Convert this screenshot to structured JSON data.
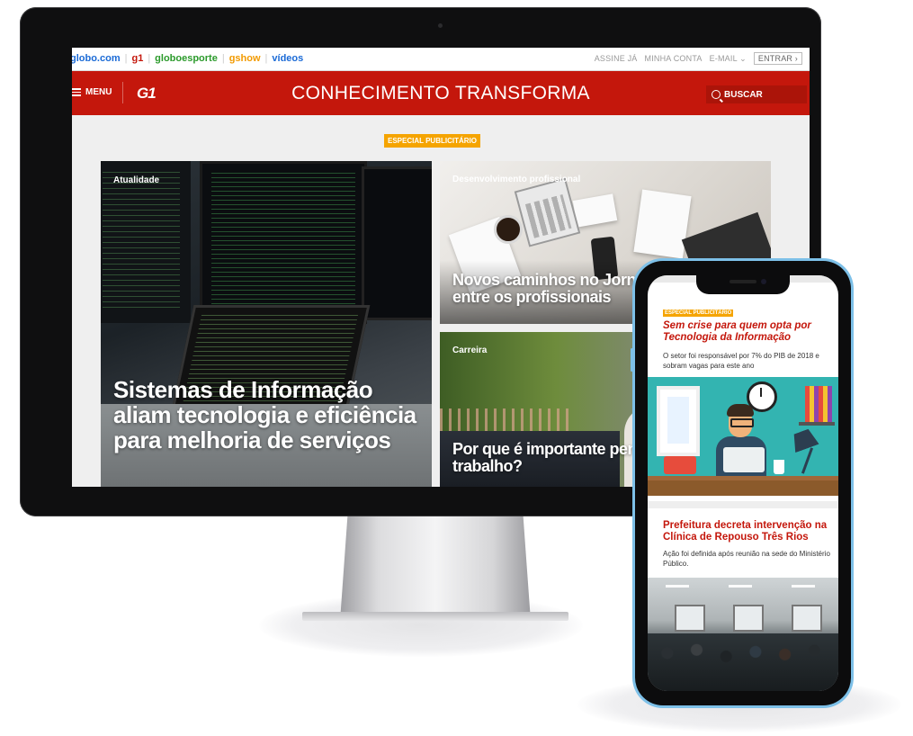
{
  "colors": {
    "brand_red": "#c4170c",
    "especial_orange": "#f5a400",
    "top_link_blue": "#1a6ad6",
    "phone_frame": "#7dc0e8"
  },
  "desktop": {
    "top_links": [
      "globo.com",
      "g1",
      "globoesporte",
      "gshow",
      "vídeos"
    ],
    "account": {
      "subscribe": "ASSINE JÁ",
      "my_account": "MINHA CONTA",
      "email": "E-MAIL ⌄",
      "login": "ENTRAR ›"
    },
    "header": {
      "menu_label": "MENU",
      "logo": "G1",
      "headline": "CONHECIMENTO TRANSFORMA",
      "search_label": "BUSCAR",
      "search_icon": "search-icon",
      "menu_icon": "hamburger-icon"
    },
    "especial_label": "ESPECIAL PUBLICITÁRIO",
    "cards": [
      {
        "tag": "Atualidade",
        "title": "Sistemas de Informação aliam tecnologia e eficiência para melhoria de serviços"
      },
      {
        "tag": "Desenvolvimento profissional",
        "title": "Novos caminhos no Jornalismo: sucesso entre os profissionais"
      },
      {
        "tag": "Carreira",
        "title": "Por que é importante pensar no mercado de trabalho?"
      }
    ]
  },
  "mobile": {
    "especial_label": "ESPECIAL PUBLICITÁRIO",
    "article1": {
      "title": "Sem crise para quem opta por Tecnologia da Informação",
      "summary": "O setor foi responsável por 7% do PIB de 2018 e sobram vagas para este ano"
    },
    "article2": {
      "title": "Prefeitura decreta intervenção na Clínica de Repouso Três Rios",
      "summary": "Ação foi definida após reunião na sede do Ministério Público."
    }
  }
}
